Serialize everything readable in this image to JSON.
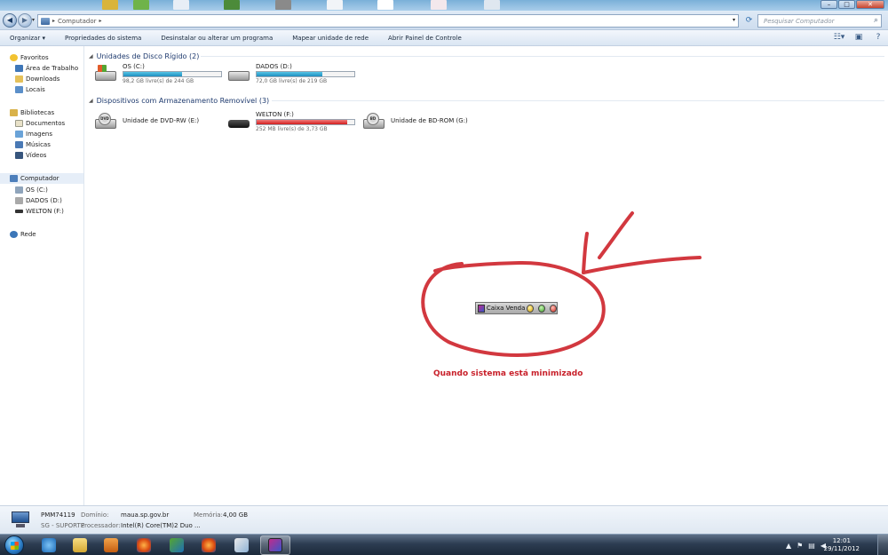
{
  "window": {
    "controls": {
      "minimize": "–",
      "maximize": "□",
      "close": "✕"
    }
  },
  "address": {
    "path_root": "Computador",
    "search_placeholder": "Pesquisar Computador"
  },
  "commands": {
    "organize": "Organizar ▾",
    "system_props": "Propriedades do sistema",
    "uninstall": "Desinstalar ou alterar um programa",
    "map_drive": "Mapear unidade de rede",
    "control_panel": "Abrir Painel de Controle"
  },
  "nav": {
    "favorites": "Favoritos",
    "desktop": "Área de Trabalho",
    "downloads": "Downloads",
    "places": "Locais",
    "libraries": "Bibliotecas",
    "documents": "Documentos",
    "images": "Imagens",
    "music": "Músicas",
    "videos": "Vídeos",
    "computer": "Computador",
    "drive_c": "OS (C:)",
    "drive_d": "DADOS (D:)",
    "drive_f": "WELTON (F:)",
    "network": "Rede"
  },
  "groups": {
    "hdd": "Unidades de Disco Rígido (2)",
    "removable": "Dispositivos com Armazenamento Removível (3)"
  },
  "drives": {
    "c": {
      "name": "OS (C:)",
      "free": "98,2 GB livre(s) de 244 GB",
      "used_fraction": 0.6
    },
    "d": {
      "name": "DADOS (D:)",
      "free": "72,0 GB livre(s) de 219 GB",
      "used_fraction": 0.67
    },
    "e": {
      "name": "Unidade de DVD-RW (E:)",
      "label": "DVD"
    },
    "f": {
      "name": "WELTON (F:)",
      "free": "252 MB livre(s) de 3,73 GB",
      "used_fraction": 0.93
    },
    "g": {
      "name": "Unidade de BD-ROM (G:)",
      "label": "BD"
    }
  },
  "annotation": {
    "mini_window_title": "Caixa Venda",
    "caption": "Quando sistema está minimizado"
  },
  "details": {
    "name": "PMM74119",
    "workgroup": "SG - SUPORTE",
    "domain_label": "Domínio:",
    "domain_value": "maua.sp.gov.br",
    "processor_label": "Processador:",
    "processor_value": "Intel(R) Core(TM)2 Duo ...",
    "memory_label": "Memória:",
    "memory_value": "4,00 GB"
  },
  "taskbar": {
    "time": "12:01",
    "date": "29/11/2012"
  },
  "colors": {
    "annotation_red": "#d2383f",
    "bar_blue": "#1f8fbf",
    "bar_red": "#d21d1d"
  }
}
